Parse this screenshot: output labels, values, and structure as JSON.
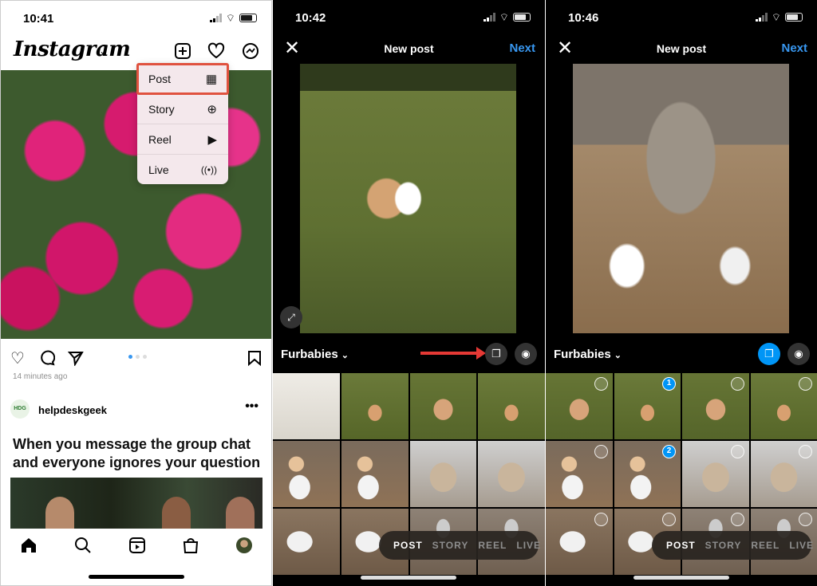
{
  "panel1": {
    "time": "10:41",
    "logo": "Instagram",
    "create_menu": [
      {
        "label": "Post",
        "icon": "grid-icon",
        "glyph": "▦",
        "highlighted": true
      },
      {
        "label": "Story",
        "icon": "story-add-icon",
        "glyph": "⊕"
      },
      {
        "label": "Reel",
        "icon": "reel-icon",
        "glyph": "▶"
      },
      {
        "label": "Live",
        "icon": "live-icon",
        "glyph": "((•))"
      }
    ],
    "posted_ago": "14 minutes ago",
    "author": {
      "username": "helpdeskgeek",
      "avatar_text": "HELP DESK GEEK"
    },
    "more": "•••",
    "caption": "When you message the group chat and everyone ignores your question",
    "carousel": {
      "count": 3,
      "active": 1
    },
    "accent": "#3897f0",
    "highlight_color": "#e0523f"
  },
  "panel2": {
    "time": "10:42",
    "title": "New post",
    "next": "Next",
    "album": "Furbabies",
    "multi_select_active": false,
    "modes": [
      "POST",
      "STORY",
      "REEL",
      "LIVE"
    ],
    "active_mode": "POST"
  },
  "panel3": {
    "time": "10:46",
    "title": "New post",
    "next": "Next",
    "album": "Furbabies",
    "multi_select_active": true,
    "selection_badges": [
      "1",
      "2"
    ],
    "modes": [
      "POST",
      "STORY",
      "REEL",
      "LIVE"
    ],
    "active_mode": "POST",
    "accent": "#0095f6"
  },
  "glyphs": {
    "close": "✕",
    "chevron": "⌄",
    "camera": "📷",
    "expand": "⤢",
    "multi": "❐"
  }
}
